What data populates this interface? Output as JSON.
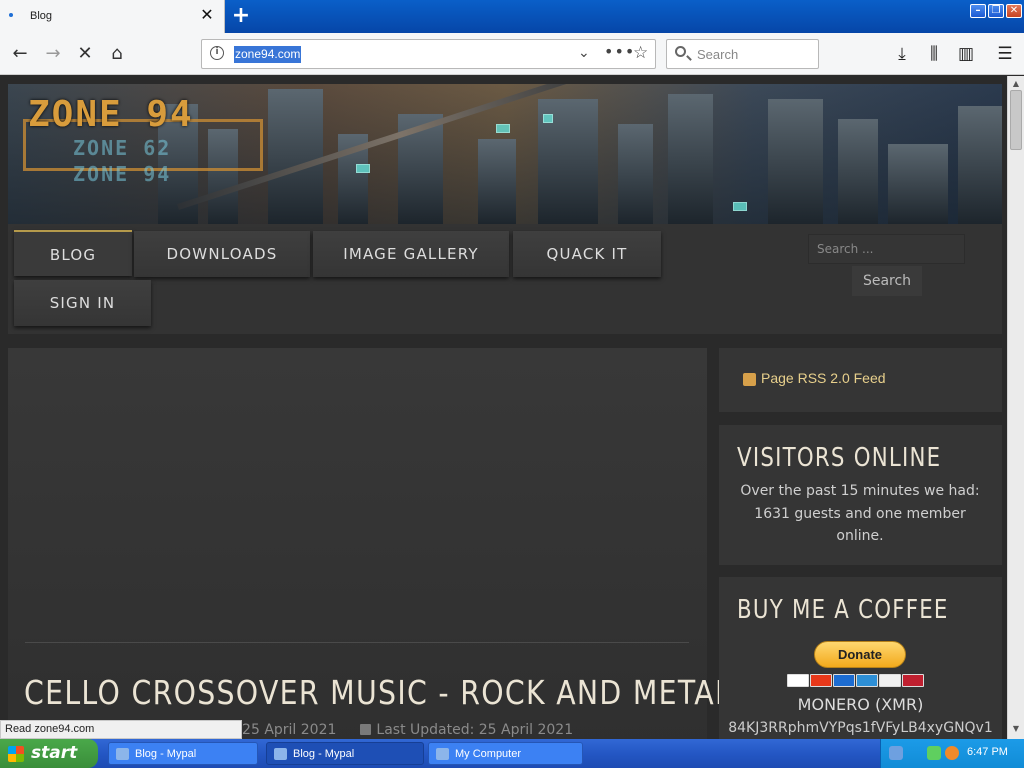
{
  "browser": {
    "tab_title": "Blog",
    "url": "zone94.com",
    "search_placeholder": "Search"
  },
  "site": {
    "logo_main": "ZONE 94",
    "logo_sub1": "ZONE 62",
    "logo_sub2": "ZONE 94",
    "menu": [
      "BLOG",
      "DOWNLOADS",
      "IMAGE GALLERY",
      "QUACK IT",
      "SIGN IN"
    ],
    "search_placeholder": "Search ...",
    "search_button": "Search"
  },
  "article": {
    "title": "CELLO CROSSOVER MUSIC - ROCK AND METAL",
    "published_partial": "d: 25 April 2021",
    "updated": "Last Updated: 25 April 2021"
  },
  "sidebar": {
    "rss_label": "Page RSS 2.0 Feed",
    "visitors_heading": "VISITORS ONLINE",
    "visitors_text": "Over the past 15 minutes we had: 1631 guests and one member online.",
    "coffee_heading": "BUY ME A COFFEE",
    "donate_label": "Donate",
    "monero_label": "MONERO (XMR)",
    "monero_address": "84KJ3RRphmVYPqs1fVFyLB4xyGNQv1"
  },
  "status_hint": "Read zone94.com",
  "taskbar": {
    "start_label": "start",
    "tasks": [
      "Blog - Mypal",
      "Blog - Mypal",
      "My Computer"
    ],
    "clock": "6:47 PM"
  }
}
